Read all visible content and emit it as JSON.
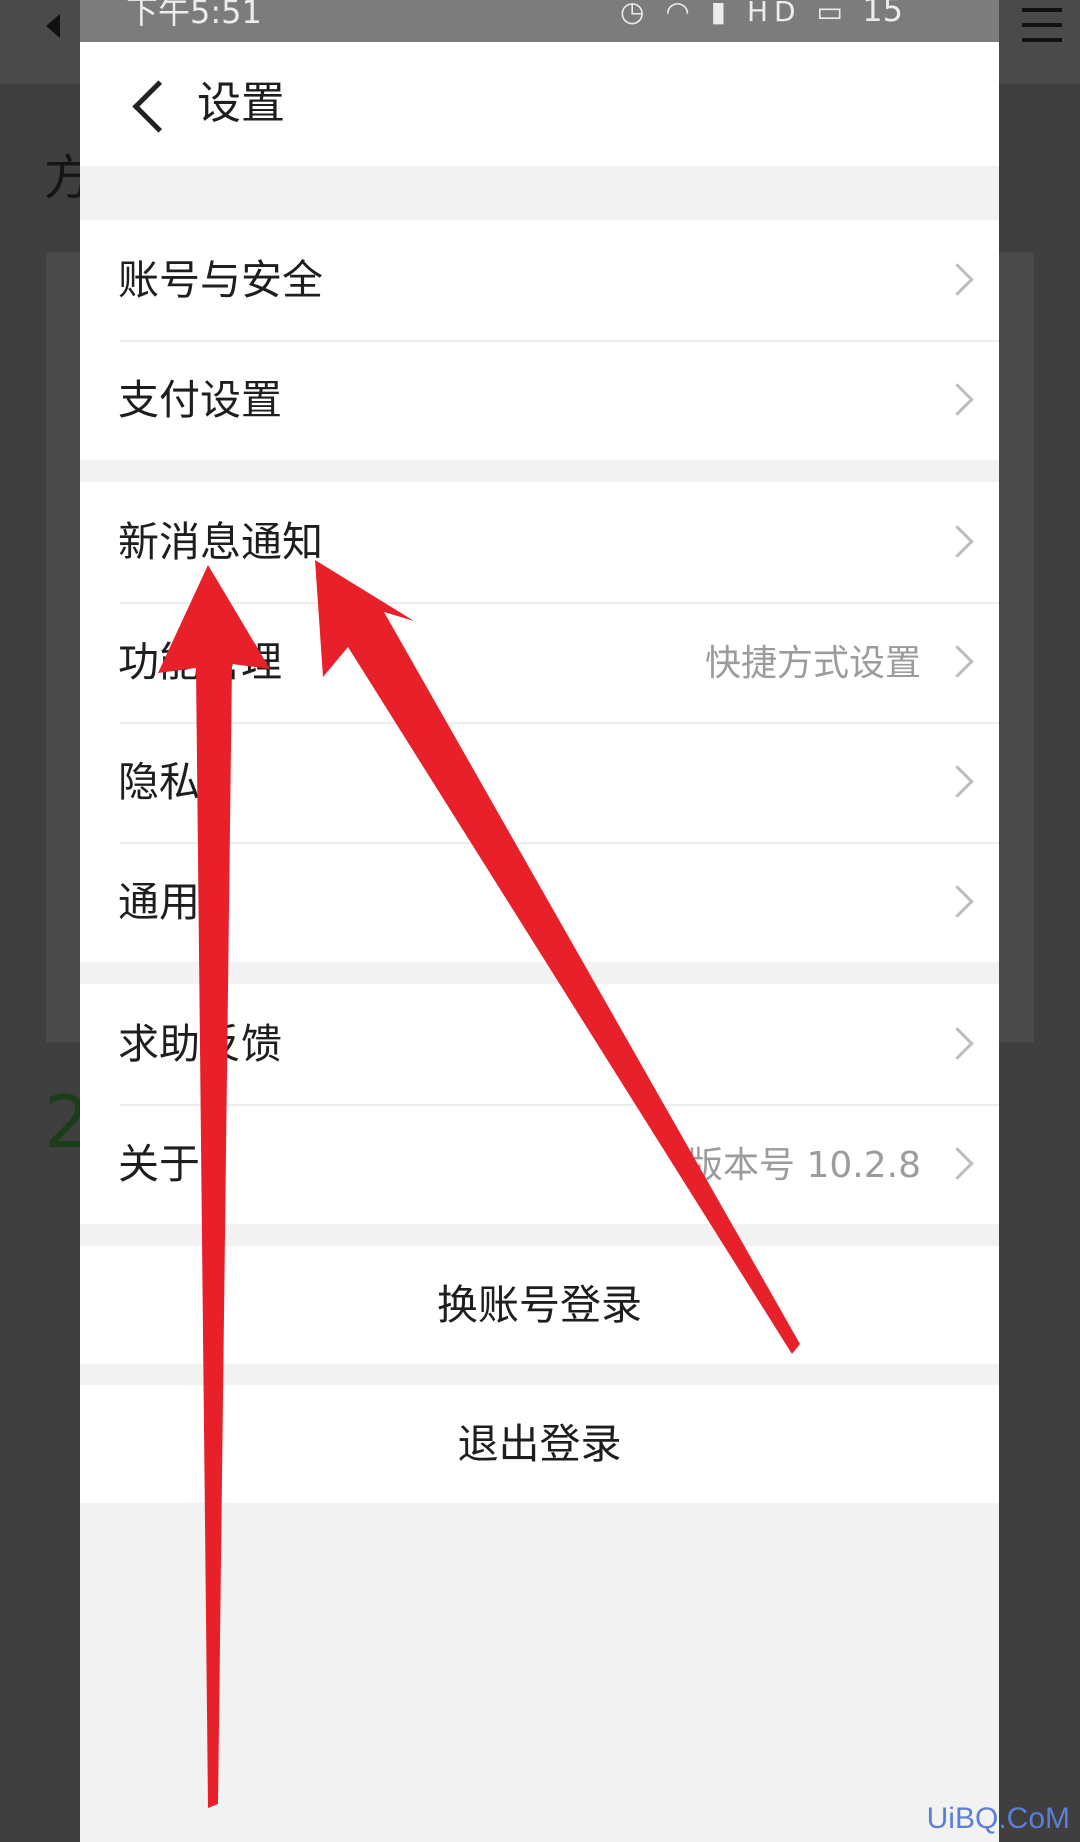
{
  "status_bar": {
    "time": "下午5:51",
    "icons": [
      "alarm-icon",
      "wifi-icon",
      "signal-icon",
      "hd-icon",
      "battery-icon"
    ],
    "battery": "15"
  },
  "header": {
    "title": "设置"
  },
  "groups": [
    [
      {
        "label": "账号与安全",
        "value": ""
      },
      {
        "label": "支付设置",
        "value": ""
      }
    ],
    [
      {
        "label": "新消息通知",
        "value": ""
      },
      {
        "label": "功能管理",
        "value": "快捷方式设置"
      },
      {
        "label": "隐私",
        "value": ""
      },
      {
        "label": "通用",
        "value": ""
      }
    ],
    [
      {
        "label": "求助反馈",
        "value": ""
      },
      {
        "label": "关于",
        "value": "版本号 10.2.8"
      }
    ]
  ],
  "buttons": {
    "switch_account": "换账号登录",
    "logout": "退出登录"
  },
  "background_page": {
    "fragment_top": "方",
    "fragment_number": "2"
  },
  "annotation": {
    "arrow_color": "#e8202a",
    "arrow_count": 2
  },
  "watermark": "UiBQ.CoM"
}
